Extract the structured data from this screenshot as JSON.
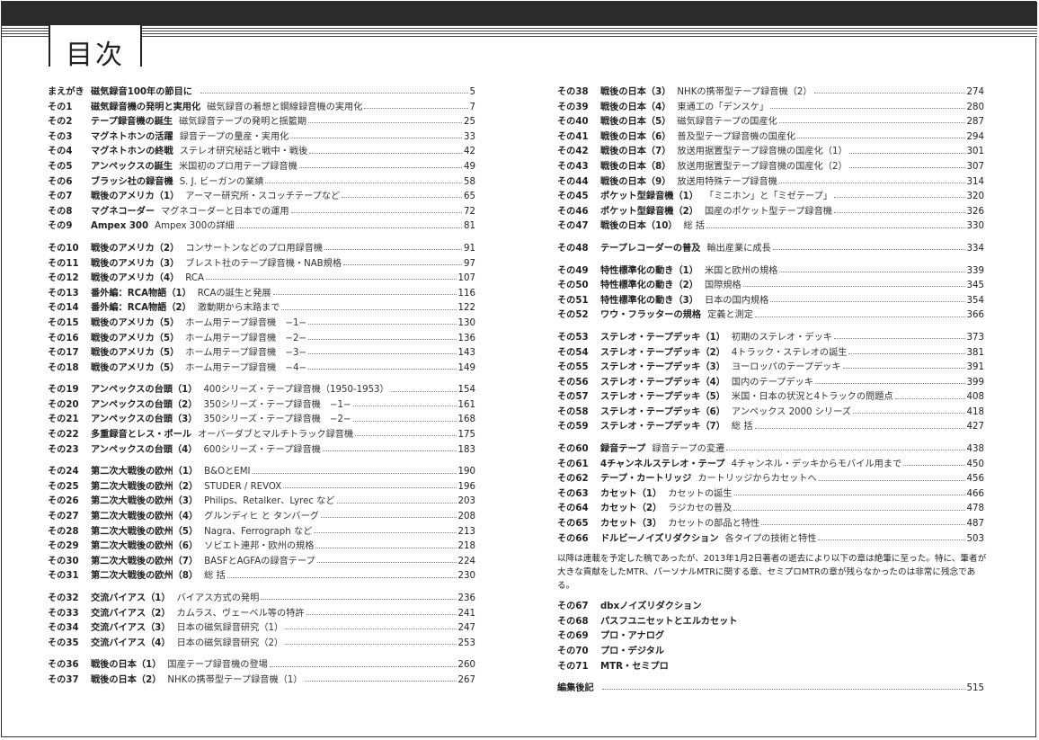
{
  "header": {
    "title": "目次"
  },
  "left": [
    {
      "num": "まえがき",
      "title": "磁気録音100年の節目に",
      "sub": "",
      "page": "5"
    },
    {
      "num": "その1",
      "title": "磁気録音機の発明と実用化",
      "sub": "磁気録音の着想と鋼線録音機の実用化",
      "page": "7"
    },
    {
      "num": "その2",
      "title": "テープ録音機の誕生",
      "sub": "磁気録音テープの発明と揺籃期",
      "page": "25"
    },
    {
      "num": "その3",
      "title": "マグネトホンの活躍",
      "sub": "録音テープの量産・実用化",
      "page": "33"
    },
    {
      "num": "その4",
      "title": "マグネトホンの終戦",
      "sub": "ステレオ研究秘話と戦中・戦後",
      "page": "42"
    },
    {
      "num": "その5",
      "title": "アンペックスの誕生",
      "sub": "米国初のプロ用テープ録音機",
      "page": "49"
    },
    {
      "num": "その6",
      "title": "ブラッシ社の録音機",
      "sub": "S. J. ビーガンの業績",
      "page": "58"
    },
    {
      "num": "その7",
      "title": "戦後のアメリカ（1）",
      "sub": "アーマー研究所・スコッチテープなど",
      "page": "65"
    },
    {
      "num": "その8",
      "title": "マグネコーダー",
      "sub": "マグネコーダーと日本での運用",
      "page": "72"
    },
    {
      "num": "その9",
      "title": "Ampex 300",
      "sub": "Ampex 300の詳細",
      "page": "81"
    },
    {
      "num": "その10",
      "title": "戦後のアメリカ（2）",
      "sub": "コンサートンなどのプロ用録音機",
      "page": "91",
      "gap": true
    },
    {
      "num": "その11",
      "title": "戦後のアメリカ（3）",
      "sub": "ブレスト社のテープ録音機・NAB規格",
      "page": "97"
    },
    {
      "num": "その12",
      "title": "戦後のアメリカ（4）",
      "sub": "RCA",
      "page": "107"
    },
    {
      "num": "その13",
      "title": "番外編：RCA物語（1）",
      "sub": "RCAの誕生と発展",
      "page": "116"
    },
    {
      "num": "その14",
      "title": "番外編：RCA物語（2）",
      "sub": "激動期から末路まで",
      "page": "122"
    },
    {
      "num": "その15",
      "title": "戦後のアメリカ（5）",
      "sub": "ホーム用テープ録音機　−1−",
      "page": "130"
    },
    {
      "num": "その16",
      "title": "戦後のアメリカ（5）",
      "sub": "ホーム用テープ録音機　−2−",
      "page": "136"
    },
    {
      "num": "その17",
      "title": "戦後のアメリカ（5）",
      "sub": "ホーム用テープ録音機　−3−",
      "page": "143"
    },
    {
      "num": "その18",
      "title": "戦後のアメリカ（5）",
      "sub": "ホーム用テープ録音機　−4−",
      "page": "149"
    },
    {
      "num": "その19",
      "title": "アンペックスの台頭（1）",
      "sub": "400シリーズ・テープ録音機（1950-1953）",
      "page": "154",
      "gap": true
    },
    {
      "num": "その20",
      "title": "アンペックスの台頭（2）",
      "sub": "350シリーズ・テープ録音機　−1−",
      "page": "161"
    },
    {
      "num": "その21",
      "title": "アンペックスの台頭（3）",
      "sub": "350シリーズ・テープ録音機　−2−",
      "page": "168"
    },
    {
      "num": "その22",
      "title": "多重録音とレス・ポール",
      "sub": "オーバーダブとマルチトラック録音機",
      "page": "175"
    },
    {
      "num": "その23",
      "title": "アンペックスの台頭（4）",
      "sub": "600シリーズ・テープ録音機",
      "page": "183"
    },
    {
      "num": "その24",
      "title": "第二次大戦後の欧州（1）",
      "sub": "B&OとEMI",
      "page": "190",
      "gap": true
    },
    {
      "num": "その25",
      "title": "第二次大戦後の欧州（2）",
      "sub": "STUDER / REVOX",
      "page": "196"
    },
    {
      "num": "その26",
      "title": "第二次大戦後の欧州（3）",
      "sub": "Philips、Retalker、Lyrec など",
      "page": "203"
    },
    {
      "num": "その27",
      "title": "第二次大戦後の欧州（4）",
      "sub": "グルンディヒ と タンバーグ",
      "page": "208"
    },
    {
      "num": "その28",
      "title": "第二次大戦後の欧州（5）",
      "sub": "Nagra、Ferrograph など",
      "page": "213"
    },
    {
      "num": "その29",
      "title": "第二次大戦後の欧州（6）",
      "sub": "ソビエト連邦・欧州の規格",
      "page": "218"
    },
    {
      "num": "その30",
      "title": "第二次大戦後の欧州（7）",
      "sub": "BASFとAGFAの録音テープ",
      "page": "224"
    },
    {
      "num": "その31",
      "title": "第二次大戦後の欧州（8）",
      "sub": "総 括",
      "page": "230"
    },
    {
      "num": "その32",
      "title": "交流バイアス（1）",
      "sub": "バイアス方式の発明",
      "page": "236",
      "gap": true
    },
    {
      "num": "その33",
      "title": "交流バイアス（2）",
      "sub": "カムラス、ヴェーベル等の特許",
      "page": "241"
    },
    {
      "num": "その34",
      "title": "交流バイアス（3）",
      "sub": "日本の磁気録音研究（1）",
      "page": "247"
    },
    {
      "num": "その35",
      "title": "交流バイアス（4）",
      "sub": "日本の磁気録音研究（2）",
      "page": "253"
    },
    {
      "num": "その36",
      "title": "戦後の日本（1）",
      "sub": "国産テープ録音機の登場",
      "page": "260",
      "gap": true
    },
    {
      "num": "その37",
      "title": "戦後の日本（2）",
      "sub": "NHKの携帯型テープ録音機（1）",
      "page": "267"
    }
  ],
  "right": [
    {
      "num": "その38",
      "title": "戦後の日本（3）",
      "sub": "NHKの携帯型テープ録音機（2）",
      "page": "274"
    },
    {
      "num": "その39",
      "title": "戦後の日本（4）",
      "sub": "東通工の「デンスケ」",
      "page": "280"
    },
    {
      "num": "その40",
      "title": "戦後の日本（5）",
      "sub": "磁気録音テープの国産化",
      "page": "287"
    },
    {
      "num": "その41",
      "title": "戦後の日本（6）",
      "sub": "普及型テープ録音機の国産化",
      "page": "294"
    },
    {
      "num": "その42",
      "title": "戦後の日本（7）",
      "sub": "放送用据置型テープ録音機の国産化（1）",
      "page": "301"
    },
    {
      "num": "その43",
      "title": "戦後の日本（8）",
      "sub": "放送用据置型テープ録音機の国産化（2）",
      "page": "307"
    },
    {
      "num": "その44",
      "title": "戦後の日本（9）",
      "sub": "放送用特殊テープ録音機",
      "page": "314"
    },
    {
      "num": "その45",
      "title": "ポケット型録音機（1）",
      "sub": "「ミニホン」と「ミゼテープ」",
      "page": "320"
    },
    {
      "num": "その46",
      "title": "ポケット型録音機（2）",
      "sub": "国産のポケット型テープ録音機",
      "page": "326"
    },
    {
      "num": "その47",
      "title": "戦後の日本（10）",
      "sub": "総 括",
      "page": "330"
    },
    {
      "num": "その48",
      "title": "テープレコーダーの普及",
      "sub": "輸出産業に成長",
      "page": "334",
      "gap": true
    },
    {
      "num": "その49",
      "title": "特性標準化の動き（1）",
      "sub": "米国と欧州の規格",
      "page": "339",
      "gap": true
    },
    {
      "num": "その50",
      "title": "特性標準化の動き（2）",
      "sub": "国際規格",
      "page": "345"
    },
    {
      "num": "その51",
      "title": "特性標準化の動き（3）",
      "sub": "日本の国内規格",
      "page": "354"
    },
    {
      "num": "その52",
      "title": "ワウ・フラッターの規格",
      "sub": "定義と測定",
      "page": "366"
    },
    {
      "num": "その53",
      "title": "ステレオ・テープデッキ（1）",
      "sub": "初期のステレオ・デッキ",
      "page": "373",
      "gap": true
    },
    {
      "num": "その54",
      "title": "ステレオ・テープデッキ（2）",
      "sub": "4トラック・ステレオの誕生",
      "page": "381"
    },
    {
      "num": "その55",
      "title": "ステレオ・テープデッキ（3）",
      "sub": "ヨーロッパのテープデッキ",
      "page": "391"
    },
    {
      "num": "その56",
      "title": "ステレオ・テープデッキ（4）",
      "sub": "国内のテープデッキ",
      "page": "399"
    },
    {
      "num": "その57",
      "title": "ステレオ・テープデッキ（5）",
      "sub": "米国・日本の状況と4トラックの問題点",
      "page": "408"
    },
    {
      "num": "その58",
      "title": "ステレオ・テープデッキ（6）",
      "sub": "アンペックス 2000 シリーズ",
      "page": "418"
    },
    {
      "num": "その59",
      "title": "ステレオ・テープデッキ（7）",
      "sub": "総 括",
      "page": "427"
    },
    {
      "num": "その60",
      "title": "録音テープ",
      "sub": "録音テープの変遷",
      "page": "438",
      "gap": true
    },
    {
      "num": "その61",
      "title": "4チャンネルステレオ・テープ",
      "sub": "4チャンネル・デッキからモバイル用まで",
      "page": "450"
    },
    {
      "num": "その62",
      "title": "テープ・カートリッジ",
      "sub": "カートリッジからカセットへ",
      "page": "456"
    },
    {
      "num": "その63",
      "title": "カセット（1）",
      "sub": "カセットの誕生",
      "page": "466"
    },
    {
      "num": "その64",
      "title": "カセット（2）",
      "sub": "ラジカセの普及",
      "page": "478"
    },
    {
      "num": "その65",
      "title": "カセット（3）",
      "sub": "カセットの部品と特性",
      "page": "487"
    },
    {
      "num": "その66",
      "title": "ドルビーノイズリダクション",
      "sub": "各タイプの技術と特性",
      "page": "503"
    }
  ],
  "note": "以降は連載を予定した稿であったが、2013年1月2日著者の逝去により以下の章は絶筆に至った。特に、筆者が大きな貢献をしたMTR、パーソナルMTRに関する章、セミプロMTRの章が残らなかったのは非常に残念である。",
  "unwritten": [
    {
      "num": "その67",
      "title": "dbxノイズリダクション"
    },
    {
      "num": "その68",
      "title": "パスフユニセットとエルカセット"
    },
    {
      "num": "その69",
      "title": "プロ・アナログ"
    },
    {
      "num": "その70",
      "title": "プロ・デジタル"
    },
    {
      "num": "その71",
      "title": "MTR・セミプロ"
    }
  ],
  "afterword": {
    "title": "編集後記",
    "page": "515"
  }
}
